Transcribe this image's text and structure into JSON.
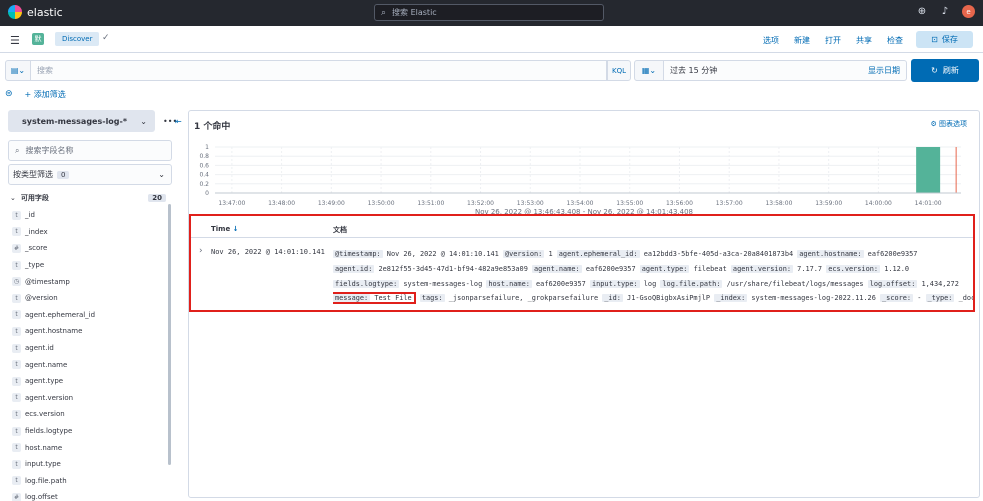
{
  "header": {
    "brand": "elastic",
    "search_placeholder": "搜索 Elastic",
    "avatar": "e",
    "icons": [
      "help-icon",
      "notifications-icon"
    ]
  },
  "appbar": {
    "app_badge": "默",
    "breadcrumb": "Discover",
    "menu": [
      "选项",
      "新建",
      "打开",
      "共享",
      "检查"
    ],
    "save_label": "保存"
  },
  "query": {
    "placeholder": "搜索",
    "language": "KQL",
    "time_range": "过去 15 分钟",
    "show_dates": "显示日期",
    "refresh_label": "刷新",
    "add_filter": "+ 添加筛选"
  },
  "sidebar": {
    "index_pattern": "system-messages-log-*",
    "field_search_placeholder": "搜索字段名称",
    "filter_by_type": "按类型筛选",
    "filter_by_type_count": "0",
    "available_fields_label": "可用字段",
    "available_fields_count": "20",
    "fields": [
      {
        "type": "t",
        "name": "_id"
      },
      {
        "type": "t",
        "name": "_index"
      },
      {
        "type": "#",
        "name": "_score"
      },
      {
        "type": "t",
        "name": "_type"
      },
      {
        "type": "clock",
        "name": "@timestamp"
      },
      {
        "type": "t",
        "name": "@version"
      },
      {
        "type": "t",
        "name": "agent.ephemeral_id"
      },
      {
        "type": "t",
        "name": "agent.hostname"
      },
      {
        "type": "t",
        "name": "agent.id"
      },
      {
        "type": "t",
        "name": "agent.name"
      },
      {
        "type": "t",
        "name": "agent.type"
      },
      {
        "type": "t",
        "name": "agent.version"
      },
      {
        "type": "t",
        "name": "ecs.version"
      },
      {
        "type": "t",
        "name": "fields.logtype"
      },
      {
        "type": "t",
        "name": "host.name"
      },
      {
        "type": "t",
        "name": "input.type"
      },
      {
        "type": "t",
        "name": "log.file.path"
      },
      {
        "type": "#",
        "name": "log.offset"
      }
    ]
  },
  "main": {
    "hits": "1 个命中",
    "chart_options": "图表选项",
    "time_span": "Nov 26, 2022 @ 13:46:43.408 - Nov 26, 2022 @ 14:01:43.408",
    "table_headers": {
      "time": "Time",
      "document": "文档"
    },
    "row": {
      "time": "Nov 26, 2022 @ 14:01:10.141",
      "pairs": [
        [
          [
            "@timestamp:",
            "Nov 26, 2022 @ 14:01:10.141"
          ],
          [
            "@version:",
            "1"
          ],
          [
            "agent.ephemeral_id:",
            "ea12bdd3-5bfe-405d-a3ca-20a8401873b4"
          ],
          [
            "agent.hostname:",
            "eaf6200e9357"
          ]
        ],
        [
          [
            "agent.id:",
            "2e812f55-3d45-47d1-bf94-482a9e853a09"
          ],
          [
            "agent.name:",
            "eaf6200e9357"
          ],
          [
            "agent.type:",
            "filebeat"
          ],
          [
            "agent.version:",
            "7.17.7"
          ],
          [
            "ecs.version:",
            "1.12.0"
          ]
        ],
        [
          [
            "fields.logtype:",
            "system-messages-log"
          ],
          [
            "host.name:",
            "eaf6200e9357"
          ],
          [
            "input.type:",
            "log"
          ],
          [
            "log.file.path:",
            "/usr/share/filebeat/logs/messages"
          ],
          [
            "log.offset:",
            "1,434,272"
          ]
        ],
        [
          [
            "message:",
            "Test File"
          ],
          [
            "tags:",
            "_jsonparsefailure, _grokparsefailure"
          ],
          [
            "_id:",
            "J1-GsoQBigbxAsiPmjlP"
          ],
          [
            "_index:",
            "system-messages-log-2022.11.26"
          ],
          [
            "_score:",
            " -"
          ],
          [
            "_type:",
            "_doc"
          ]
        ]
      ]
    }
  },
  "chart_data": {
    "type": "bar",
    "x": [
      "13:47:00",
      "13:48:00",
      "13:49:00",
      "13:50:00",
      "13:51:00",
      "13:52:00",
      "13:53:00",
      "13:54:00",
      "13:55:00",
      "13:56:00",
      "13:57:00",
      "13:58:00",
      "13:59:00",
      "14:00:00",
      "14:01:00"
    ],
    "series": [
      {
        "values": [
          0,
          0,
          0,
          0,
          0,
          0,
          0,
          0,
          0,
          0,
          0,
          0,
          0,
          0,
          1
        ]
      }
    ],
    "yticks": [
      "1",
      "0.8",
      "0.6",
      "0.4",
      "0.2",
      "0"
    ],
    "ylim": [
      0,
      1
    ],
    "bar_color": "#54b399",
    "now_marker_color": "#e7664c"
  },
  "colors": {
    "accent": "#006bb4",
    "header_bg": "#25282f",
    "highlight": "#e0201b"
  }
}
